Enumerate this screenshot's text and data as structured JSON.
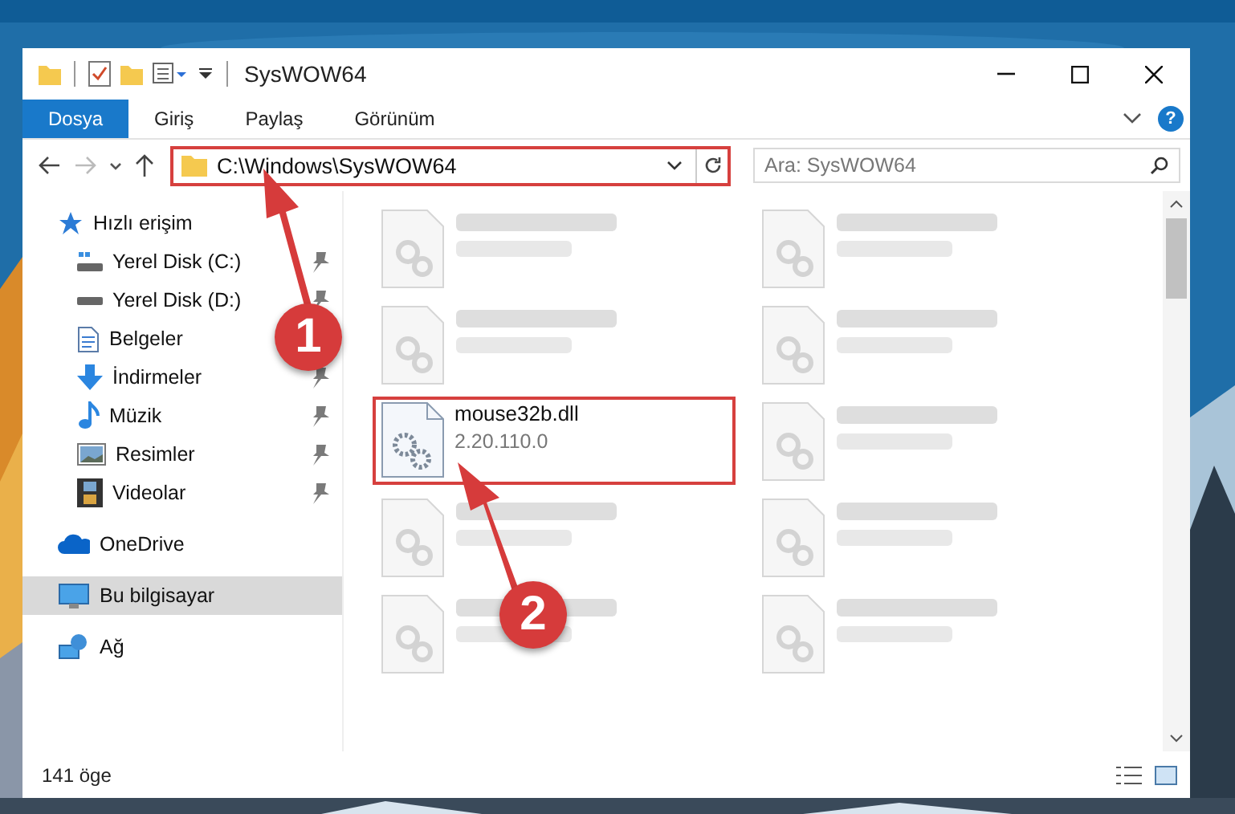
{
  "window": {
    "title": "SysWOW64"
  },
  "ribbon_tabs": [
    {
      "label": "Dosya",
      "selected": true
    },
    {
      "label": "Giriş",
      "selected": false
    },
    {
      "label": "Paylaş",
      "selected": false
    },
    {
      "label": "Görünüm",
      "selected": false
    }
  ],
  "help_label": "?",
  "address": {
    "path": "C:\\Windows\\SysWOW64",
    "highlighted": true
  },
  "search": {
    "placeholder": "Ara: SysWOW64"
  },
  "navigation": [
    {
      "label": "Hızlı erişim",
      "kind": "quick",
      "selected": false,
      "children": [
        {
          "label": "Yerel Disk (C:)",
          "kind": "system-drive",
          "pinned": true
        },
        {
          "label": "Yerel Disk (D:)",
          "kind": "drive",
          "pinned": true
        },
        {
          "label": "Belgeler",
          "kind": "documents",
          "pinned": false
        },
        {
          "label": "İndirmeler",
          "kind": "downloads",
          "pinned": true
        },
        {
          "label": "Müzik",
          "kind": "music",
          "pinned": true
        },
        {
          "label": "Resimler",
          "kind": "pictures",
          "pinned": true
        },
        {
          "label": "Videolar",
          "kind": "videos",
          "pinned": true
        }
      ]
    },
    {
      "label": "OneDrive",
      "kind": "cloud",
      "selected": false
    },
    {
      "label": "Bu bilgisayar",
      "kind": "computer",
      "selected": true
    },
    {
      "label": "Ağ",
      "kind": "network",
      "selected": false
    }
  ],
  "files": [
    {
      "kind": "blurred"
    },
    {
      "kind": "blurred"
    },
    {
      "kind": "blurred"
    },
    {
      "kind": "blurred"
    },
    {
      "kind": "file",
      "name": "mouse32b.dll",
      "detail": "2.20.110.0",
      "highlighted": true
    },
    {
      "kind": "blurred"
    },
    {
      "kind": "blurred"
    },
    {
      "kind": "blurred"
    },
    {
      "kind": "blurred"
    },
    {
      "kind": "blurred"
    }
  ],
  "status_bar": {
    "item_count": "141 öge"
  },
  "callouts": [
    {
      "label": "1"
    },
    {
      "label": "2"
    }
  ]
}
